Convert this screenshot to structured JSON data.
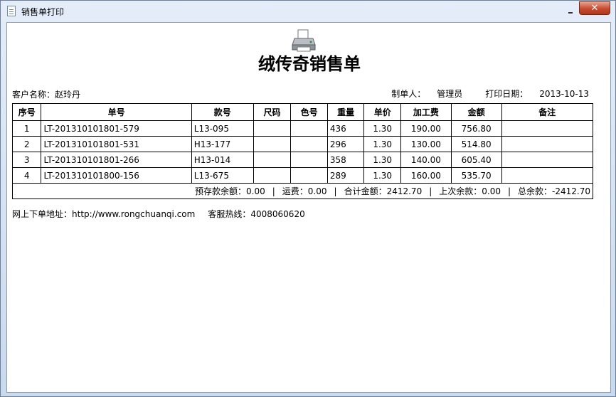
{
  "window": {
    "title": "销售单打印",
    "close_glyph": "✕"
  },
  "document": {
    "title": "绒传奇销售单",
    "customer_label": "客户名称：",
    "customer_name": "赵玲丹",
    "maker_label": "制单人：",
    "maker_name": "管理员",
    "print_date_label": "打印日期：",
    "print_date": "2013-10-13"
  },
  "table": {
    "headers": [
      "序号",
      "单号",
      "款号",
      "尺码",
      "色号",
      "重量",
      "单价",
      "加工费",
      "金额",
      "备注"
    ],
    "rows": [
      [
        "1",
        "LT-201310101801-579",
        "L13-095",
        "",
        "",
        "436",
        "1.30",
        "190.00",
        "756.80",
        ""
      ],
      [
        "2",
        "LT-201310101801-531",
        "H13-177",
        "",
        "",
        "296",
        "1.30",
        "130.00",
        "514.80",
        ""
      ],
      [
        "3",
        "LT-201310101801-266",
        "H13-014",
        "",
        "",
        "358",
        "1.30",
        "140.00",
        "605.40",
        ""
      ],
      [
        "4",
        "LT-201310101800-156",
        "L13-675",
        "",
        "",
        "289",
        "1.30",
        "160.00",
        "535.70",
        ""
      ]
    ],
    "summary": {
      "deposit_label": "预存款余额：",
      "deposit": "0.00",
      "freight_label": "运费：",
      "freight": "0.00",
      "total_label": "合计金额：",
      "total": "2412.70",
      "last_balance_label": "上次余款：",
      "last_balance": "0.00",
      "grand_label": "总余款：",
      "grand": "-2412.70",
      "separator": "|"
    }
  },
  "footer": {
    "url_label": "网上下单地址：",
    "url": "http://www.rongchuanqi.com",
    "hotline_label": "客服热线：",
    "hotline": "4008060620"
  },
  "icons": {
    "title": "document-icon",
    "printer": "printer-icon"
  }
}
